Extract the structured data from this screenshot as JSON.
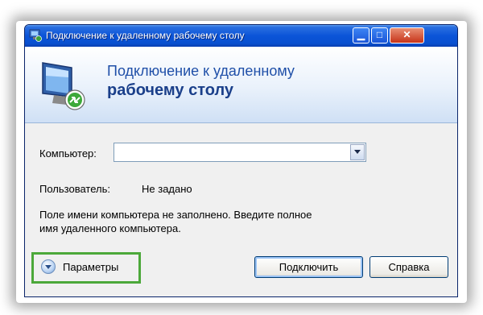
{
  "window": {
    "title": "Подключение к удаленному рабочему столу",
    "header_line1": "Подключение к удаленному",
    "header_line2": "рабочему столу"
  },
  "form": {
    "computer_label": "Компьютер:",
    "computer_value": "",
    "user_label": "Пользователь:",
    "user_value": "Не задано",
    "message_line1": "Поле имени компьютера не заполнено. Введите полное",
    "message_line2": "имя удаленного компьютера."
  },
  "buttons": {
    "options_label": "Параметры",
    "connect_label": "Подключить",
    "help_label": "Справка"
  },
  "colors": {
    "title_bar": "#0b54d8",
    "highlight": "#4ca83a"
  },
  "icons": [
    "remote-desktop-icon",
    "minimize-icon",
    "maximize-icon",
    "close-icon",
    "dropdown-arrow-icon",
    "expand-options-icon"
  ]
}
